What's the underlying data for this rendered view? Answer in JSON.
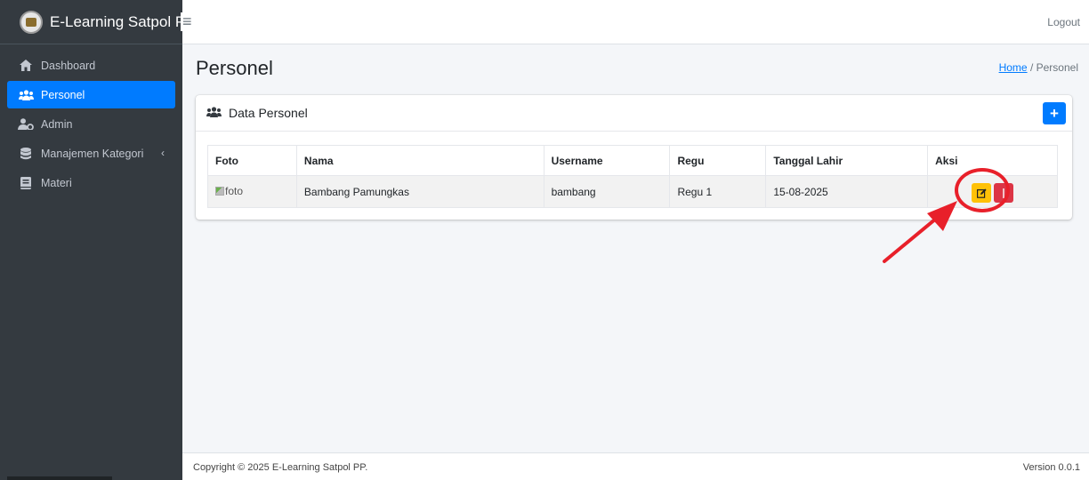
{
  "brand": {
    "title": "E-Learning Satpol PP",
    "logo_icon": "satpol-emblem-icon"
  },
  "topbar": {
    "menu_icon": "hamburger-icon",
    "logout_label": "Logout"
  },
  "sidebar": {
    "items": [
      {
        "label": "Dashboard",
        "icon": "home-icon",
        "active": false
      },
      {
        "label": "Personel",
        "icon": "users-icon",
        "active": true
      },
      {
        "label": "Admin",
        "icon": "user-cog-icon",
        "active": false
      },
      {
        "label": "Manajemen Kategori",
        "icon": "database-icon",
        "active": false,
        "has_caret": true
      },
      {
        "label": "Materi",
        "icon": "book-icon",
        "active": false
      }
    ]
  },
  "page": {
    "title": "Personel",
    "breadcrumb": {
      "home": "Home",
      "separator": "/",
      "current": "Personel"
    }
  },
  "card": {
    "title": "Data Personel",
    "add_icon": "plus-icon",
    "add_label": "+"
  },
  "table": {
    "headers": [
      "Foto",
      "Nama",
      "Username",
      "Regu",
      "Tanggal Lahir",
      "Aksi"
    ],
    "rows": [
      {
        "foto_alt": "foto",
        "nama": "Bambang Pamungkas",
        "username": "bambang",
        "regu": "Regu 1",
        "tanggal_lahir": "15-08-2025"
      }
    ]
  },
  "footer": {
    "copyright": "Copyright © 2025 E-Learning Satpol PP.",
    "version": "Version 0.0.1"
  },
  "colors": {
    "primary": "#007bff",
    "sidebar_bg": "#343a40",
    "warning": "#ffc107",
    "danger": "#dc3545",
    "annotation": "#e8202a"
  }
}
